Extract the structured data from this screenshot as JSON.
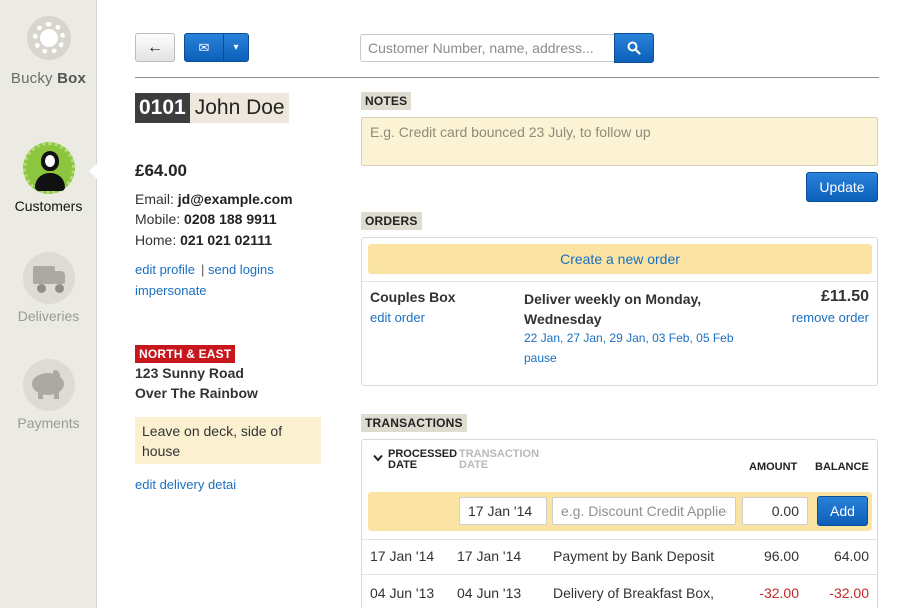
{
  "sidebar": {
    "logo": {
      "brand_a": "Bucky",
      "brand_b": "Box"
    },
    "items": [
      {
        "label": "Customers",
        "icon": "customer-icon",
        "active": true
      },
      {
        "label": "Deliveries",
        "icon": "truck-icon",
        "active": false
      },
      {
        "label": "Payments",
        "icon": "piggy-bank-icon",
        "active": false
      }
    ]
  },
  "toolbar": {
    "back_icon": "←",
    "mail_icon": "✉",
    "caret_icon": "▾",
    "search_placeholder": "Customer Number, name, address...",
    "search_value": ""
  },
  "customer": {
    "number": "0101",
    "name": "John Doe",
    "balance": "£64.00",
    "email_label": "Email:",
    "email": "jd@example.com",
    "mobile_label": "Mobile:",
    "mobile": "0208 188 9911",
    "home_label": "Home:",
    "home": "021 021 02111",
    "edit_profile": "edit profile",
    "separator": "|",
    "send_logins": "send logins",
    "impersonate": "impersonate",
    "route": "NORTH & EAST",
    "address_line1": "123 Sunny Road",
    "address_line2": "Over The Rainbow",
    "delivery_note": "Leave on deck, side of house",
    "edit_delivery": "edit delivery detai"
  },
  "notes": {
    "label": "NOTES",
    "placeholder": "E.g. Credit card bounced 23 July, to follow up",
    "value": "",
    "update_label": "Update"
  },
  "orders": {
    "label": "ORDERS",
    "create_label": "Create a new order",
    "items": [
      {
        "box": "Couples Box",
        "edit": "edit order",
        "schedule": "Deliver weekly on Monday, Wednesday",
        "dates": [
          "22 Jan",
          "27 Jan",
          "29 Jan",
          "03 Feb",
          "05 Feb"
        ],
        "pause": "pause",
        "price": "£11.50",
        "remove": "remove order"
      }
    ]
  },
  "transactions": {
    "label": "TRANSACTIONS",
    "headers": {
      "processed_a": "PROCESSED",
      "processed_b": "DATE",
      "transaction_a": "TRANSACTION",
      "transaction_b": "DATE",
      "amount": "AMOUNT",
      "balance": "BALANCE"
    },
    "sort_icon": "⌄",
    "form": {
      "date_value": "17 Jan '14",
      "description_placeholder": "e.g. Discount Credit Applied",
      "amount_value": "0.00",
      "add_label": "Add"
    },
    "rows": [
      {
        "processed": "17 Jan '14",
        "transaction": "17 Jan '14",
        "description": "Payment by Bank Deposit",
        "amount": "96.00",
        "balance": "64.00",
        "negative": false
      },
      {
        "processed": "04 Jun '13",
        "transaction": "04 Jun '13",
        "description": "Delivery of Breakfast Box,",
        "amount": "-32.00",
        "balance": "-32.00",
        "negative": true
      }
    ]
  },
  "colors": {
    "accent_blue": "#1a6fc2",
    "route_red": "#c8161d",
    "highlight": "#fae3a3",
    "negative": "#c62828"
  }
}
